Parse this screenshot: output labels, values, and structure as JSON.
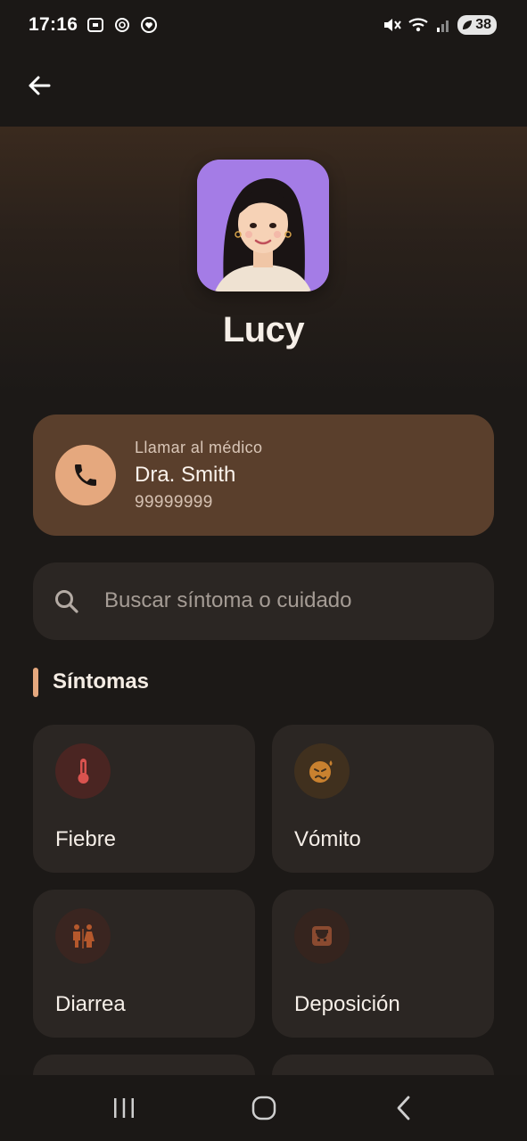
{
  "status_bar": {
    "time": "17:16",
    "battery": "38",
    "icons": [
      "screenshot-icon",
      "chatgpt-icon",
      "heart-circle-icon",
      "mute-icon",
      "wifi-icon",
      "signal-icon",
      "battery-icon"
    ]
  },
  "appbar": {
    "back_icon": "arrow-left-icon"
  },
  "profile": {
    "name": "Lucy"
  },
  "call_card": {
    "label": "Llamar al médico",
    "doctor": "Dra. Smith",
    "phone": "99999999",
    "icon": "phone-icon",
    "accent": "#e5a87e",
    "background": "#5a3f2c"
  },
  "search": {
    "placeholder": "Buscar síntoma o cuidado",
    "value": "",
    "icon": "search-icon"
  },
  "section": {
    "title": "Síntomas",
    "accent": "#e5a87e"
  },
  "symptoms": [
    {
      "label": "Fiebre",
      "icon": "thermometer-icon",
      "color": "#d9534f"
    },
    {
      "label": "Vómito",
      "icon": "sick-face-icon",
      "color": "#c9812f"
    },
    {
      "label": "Diarrea",
      "icon": "restroom-icon",
      "color": "#b5582c"
    },
    {
      "label": "Deposición",
      "icon": "toilet-icon",
      "color": "#8a4a30"
    }
  ],
  "navbar": {
    "icons": [
      "recent-apps-icon",
      "home-icon",
      "back-icon"
    ]
  }
}
